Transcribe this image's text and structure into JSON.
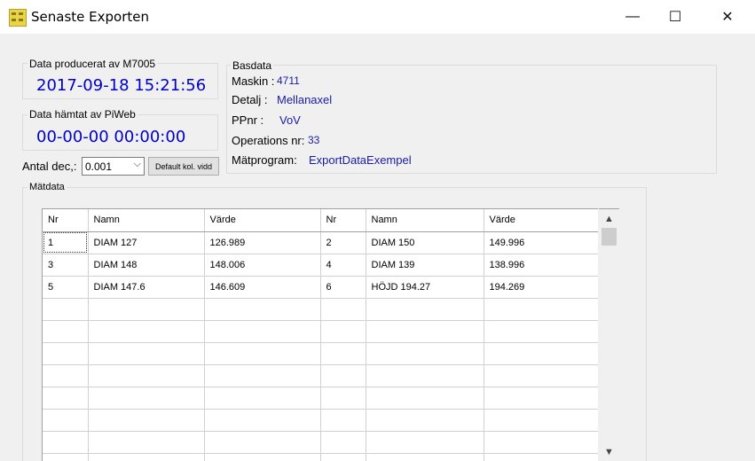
{
  "window": {
    "title": "Senaste Exporten",
    "min_glyph": "—",
    "max_glyph": "☐",
    "close_glyph": "✕"
  },
  "produced": {
    "label": "Data producerat av M7005",
    "value": "2017-09-18 15:21:56"
  },
  "fetched": {
    "label": "Data hämtat av PiWeb",
    "value": "00-00-00 00:00:00"
  },
  "decimals": {
    "label": "Antal dec,:",
    "value": "0.001",
    "button": "Default kol. vidd"
  },
  "basdata": {
    "label": "Basdata",
    "maskin_label": "Maskin :",
    "maskin_value": "4711",
    "detalj_label": "Detalj :",
    "detalj_value": "Mellanaxel",
    "ppnr_label": "PPnr :",
    "ppnr_value": "VoV",
    "opnr_label": "Operations nr:",
    "opnr_value": "33",
    "program_label": "Mätprogram:",
    "program_value": "ExportDataExempel"
  },
  "matdata": {
    "label": "Mätdata",
    "headers": [
      "Nr",
      "Namn",
      "Värde",
      "Nr",
      "Namn",
      "Värde"
    ],
    "rows": [
      [
        "1",
        "DIAM 127",
        "126.989",
        "2",
        "DIAM 150",
        "149.996"
      ],
      [
        "3",
        "DIAM 148",
        "148.006",
        "4",
        "DIAM 139",
        "138.996"
      ],
      [
        "5",
        "DIAM 147.6",
        "146.609",
        "6",
        "HÖJD 194.27",
        "194.269"
      ]
    ],
    "empty_rows": 8
  }
}
